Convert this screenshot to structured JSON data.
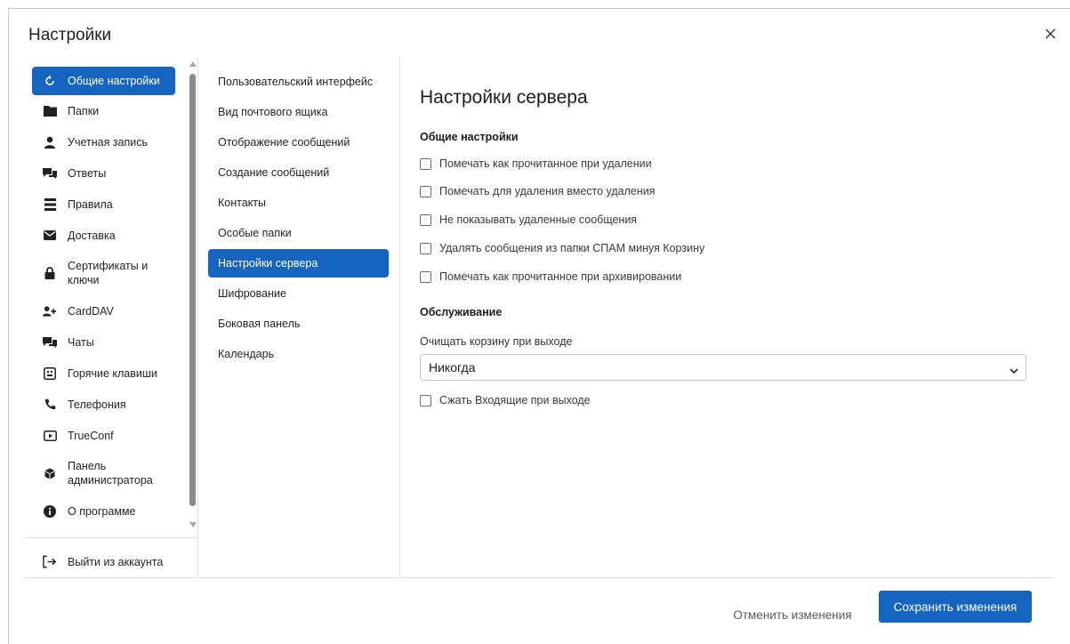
{
  "dialog": {
    "title": "Настройки"
  },
  "sidebar": {
    "items": [
      {
        "label": "Общие настройки",
        "icon": "refresh-icon"
      },
      {
        "label": "Папки",
        "icon": "folder-icon"
      },
      {
        "label": "Учетная запись",
        "icon": "user-icon"
      },
      {
        "label": "Ответы",
        "icon": "reply-icon"
      },
      {
        "label": "Правила",
        "icon": "list-icon"
      },
      {
        "label": "Доставка",
        "icon": "mail-icon"
      },
      {
        "label": "Сертификаты и ключи",
        "icon": "lock-icon"
      },
      {
        "label": "CardDAV",
        "icon": "add-user-icon"
      },
      {
        "label": "Чаты",
        "icon": "chat-icon"
      },
      {
        "label": "Горячие клавиши",
        "icon": "keyboard-icon"
      },
      {
        "label": "Телефония",
        "icon": "phone-icon"
      },
      {
        "label": "TrueConf",
        "icon": "video-icon"
      },
      {
        "label": "Панель администратора",
        "icon": "cube-icon"
      },
      {
        "label": "О программе",
        "icon": "info-icon"
      }
    ],
    "logout_label": "Выйти из аккаунта"
  },
  "subnav": {
    "items": [
      "Пользовательский интерфейс",
      "Вид почтового ящика",
      "Отображение сообщений",
      "Создание сообщений",
      "Контакты",
      "Особые папки",
      "Настройки сервера",
      "Шифрование",
      "Боковая панель",
      "Календарь"
    ]
  },
  "content": {
    "title": "Настройки сервера",
    "general_section": "Общие настройки",
    "checkboxes": [
      "Помечать как прочитанное при удалении",
      "Помечать для удаления вместо удаления",
      "Не показывать удаленные сообщения",
      "Удалять сообщения из папки СПАМ минуя Корзину",
      "Помечать как прочитанное при архивировании"
    ],
    "maintenance_section": "Обслуживание",
    "trash_label": "Очищать корзину при выходе",
    "trash_value": "Никогда",
    "compress_label": "Сжать Входящие при выходе"
  },
  "footer": {
    "cancel_label": "Отменить изменения",
    "save_label": "Сохранить изменения"
  },
  "colors": {
    "accent": "#1565c0"
  }
}
